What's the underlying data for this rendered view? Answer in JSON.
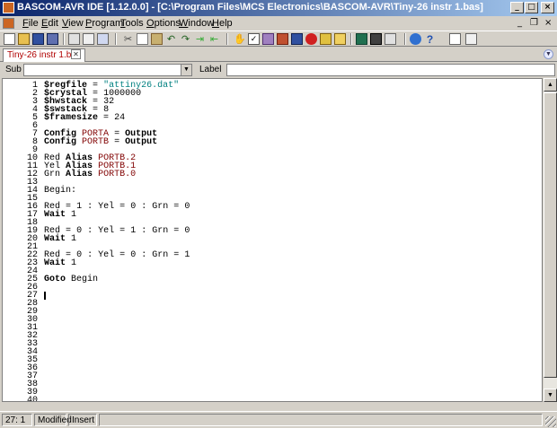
{
  "window": {
    "title": "BASCOM-AVR IDE [1.12.0.0] - [C:\\Program Files\\MCS Electronics\\BASCOM-AVR\\Tiny-26 instr 1.bas]"
  },
  "menu": [
    {
      "key": "F",
      "rest": "ile"
    },
    {
      "key": "E",
      "rest": "dit"
    },
    {
      "key": "V",
      "rest": "iew"
    },
    {
      "key": "P",
      "rest": "rogram"
    },
    {
      "key": "T",
      "rest": "ools"
    },
    {
      "key": "O",
      "rest": "ptions"
    },
    {
      "key": "W",
      "rest": "indow"
    },
    {
      "key": "H",
      "rest": "elp"
    }
  ],
  "tab": {
    "label": "Tiny-26 instr 1.bas"
  },
  "subbar": {
    "sub_label": "Sub",
    "label_label": "Label",
    "sub_value": "",
    "label_value": ""
  },
  "editor": {
    "lines": [
      "$regfile = \"attiny26.dat\"",
      "$crystal = 1000000",
      "$hwstack = 32",
      "$swstack = 8",
      "$framesize = 24",
      "",
      "Config PORTA = Output",
      "Config PORTB = Output",
      "",
      "Red Alias PORTB.2",
      "Yel Alias PORTB.1",
      "Grn Alias PORTB.0",
      "",
      "Begin:",
      "",
      "Red = 1 : Yel = 0 : Grn = 0",
      "Wait 1",
      "",
      "Red = 0 : Yel = 1 : Grn = 0",
      "Wait 1",
      "",
      "Red = 0 : Yel = 0 : Grn = 1",
      "Wait 1",
      "",
      "Goto Begin",
      "",
      "",
      "",
      "",
      "",
      "",
      "",
      "",
      "",
      "",
      "",
      "",
      "",
      "",
      ""
    ],
    "cursor_line": 27
  },
  "status": {
    "position": "27: 1",
    "modified": "Modified",
    "mode": "Insert"
  },
  "icons": [
    "new-file-icon",
    "open-folder-icon",
    "save-icon",
    "save-all-icon",
    "print-icon",
    "print-preview-icon",
    "cut-icon",
    "copy-icon",
    "paste-icon",
    "undo-icon",
    "redo-icon",
    "find-icon",
    "find-next-icon",
    "compile-icon",
    "syntax-check-icon",
    "program-chip-icon",
    "simulate-icon",
    "terminal-icon",
    "lcd-designer-icon",
    "help-icon",
    "about-icon"
  ]
}
